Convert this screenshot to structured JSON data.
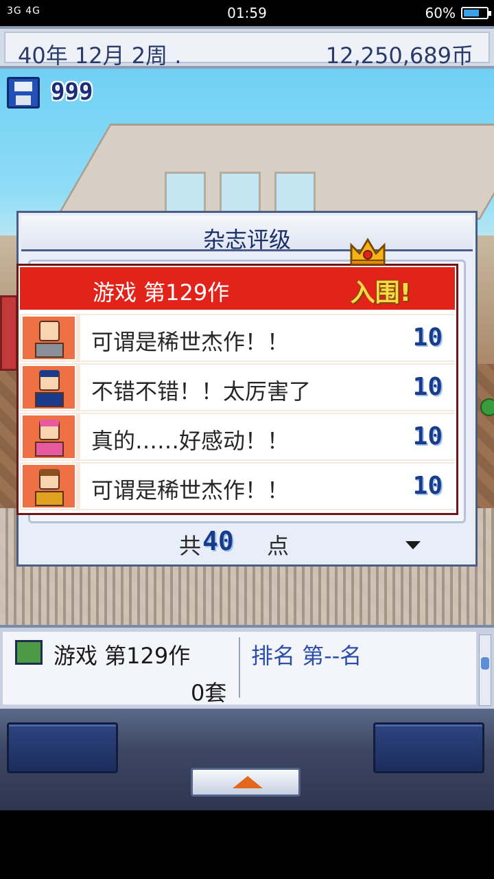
{
  "status_bar": {
    "signal": "3G 4G",
    "time": "01:59",
    "battery": "60%",
    "battery_level": 0.6
  },
  "top_bar": {
    "date": "40年 12月 2周 .",
    "money": "12,250,689币"
  },
  "save": {
    "count": "999"
  },
  "rating_panel": {
    "title": "杂志评级",
    "game_name": "游戏 第129作",
    "badge": "入围!",
    "reviews": [
      {
        "comment": "可谓是稀世杰作！！",
        "score": "10"
      },
      {
        "comment": "不错不错！！太厉害了",
        "score": "10"
      },
      {
        "comment": "真的……好感动！！",
        "score": "10"
      },
      {
        "comment": "可谓是稀世杰作！！",
        "score": "10"
      }
    ],
    "total_label": "共",
    "total_value": "40",
    "total_unit": "点"
  },
  "bottom_info": {
    "game": "游戏 第129作",
    "units": "0套",
    "rank": "排名 第--名"
  },
  "colors": {
    "header_red": "#e2231a",
    "avatar_orange": "#f07046",
    "score_blue": "#1a3a8a",
    "panel_border": "#4c5c86",
    "up_arrow": "#e3681d"
  }
}
